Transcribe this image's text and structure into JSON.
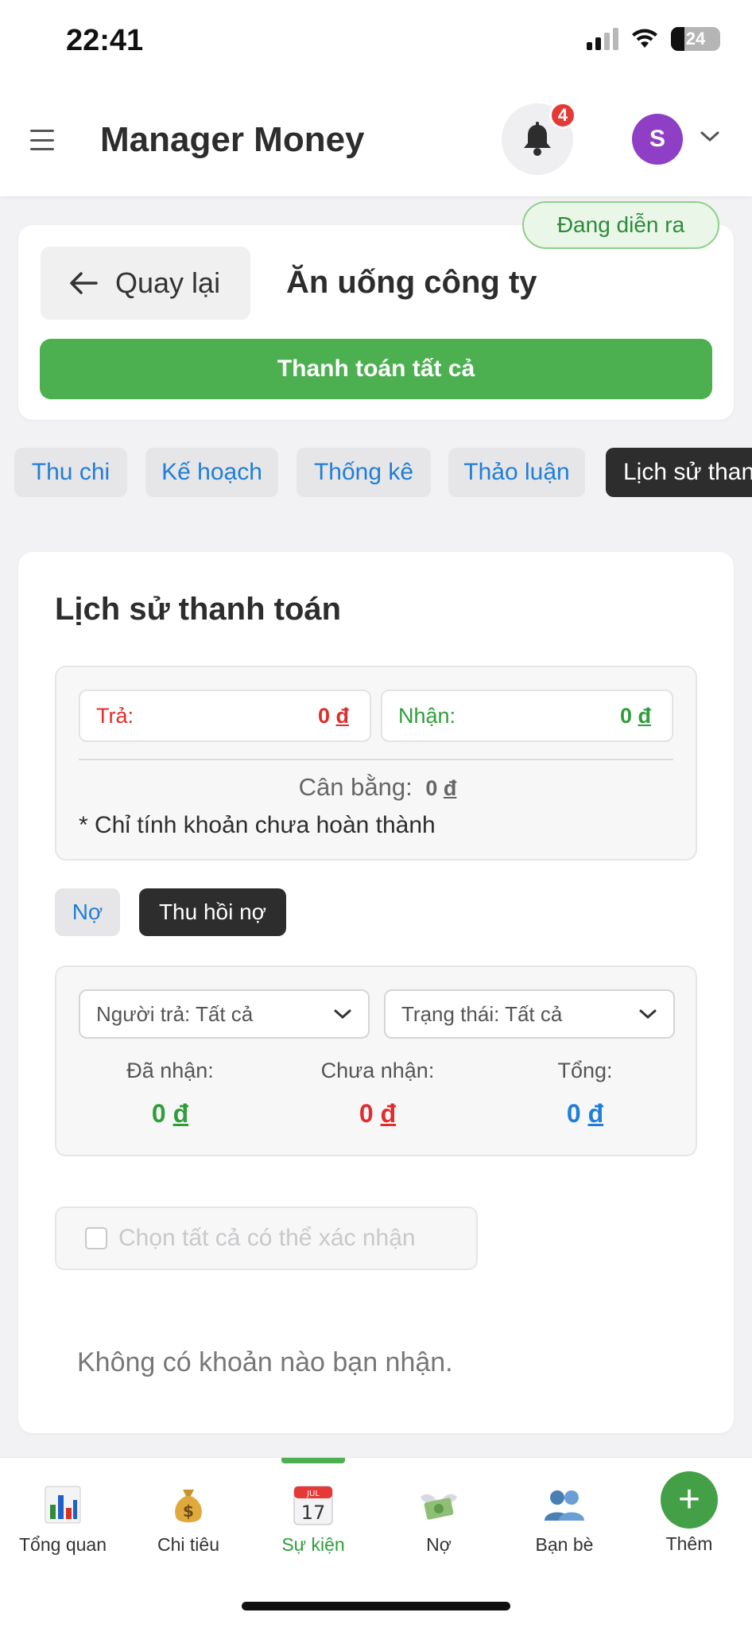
{
  "status_bar": {
    "time": "22:41",
    "battery": "24"
  },
  "header": {
    "title": "Manager Money",
    "notification_count": "4",
    "avatar_initial": "S"
  },
  "event": {
    "status": "Đang diễn ra",
    "back_label": "Quay lại",
    "title": "Ăn uống công ty",
    "pay_all_label": "Thanh toán tất cả"
  },
  "tabs": [
    {
      "label": "Thu chi"
    },
    {
      "label": "Kế hoạch"
    },
    {
      "label": "Thống kê"
    },
    {
      "label": "Thảo luận"
    },
    {
      "label": "Lịch sử thanh toán"
    }
  ],
  "history": {
    "title": "Lịch sử thanh toán",
    "pay_label": "Trả:",
    "pay_value": "0",
    "receive_label": "Nhận:",
    "receive_value": "0",
    "balance_label": "Cân bằng:",
    "balance_value": "0",
    "currency": "đ",
    "note": "* Chỉ tính khoản chưa hoàn thành",
    "subtabs": {
      "debt": "Nợ",
      "recover": "Thu hồi nợ"
    },
    "filters": {
      "payer": "Người trả: Tất cả",
      "status": "Trạng thái: Tất cả"
    },
    "stats": {
      "received_label": "Đã nhận:",
      "received_value": "0",
      "pending_label": "Chưa nhận:",
      "pending_value": "0",
      "total_label": "Tổng:",
      "total_value": "0"
    },
    "select_all_label": "Chọn tất cả có thể xác nhận",
    "empty_message": "Không có khoản nào bạn nhận."
  },
  "nav": [
    {
      "label": "Tổng quan",
      "icon": "bar-chart-icon"
    },
    {
      "label": "Chi tiêu",
      "icon": "money-bag-icon"
    },
    {
      "label": "Sự kiện",
      "icon": "calendar-icon",
      "active": true,
      "calendar_month": "JUL",
      "calendar_day": "17"
    },
    {
      "label": "Nợ",
      "icon": "money-wings-icon"
    },
    {
      "label": "Bạn bè",
      "icon": "friends-icon"
    },
    {
      "label": "Thêm",
      "icon": "plus-icon"
    }
  ],
  "colors": {
    "accent_green": "#4caf50",
    "link_blue": "#1f7ed8",
    "danger_red": "#e02d2d",
    "dark": "#2d2d2d"
  }
}
